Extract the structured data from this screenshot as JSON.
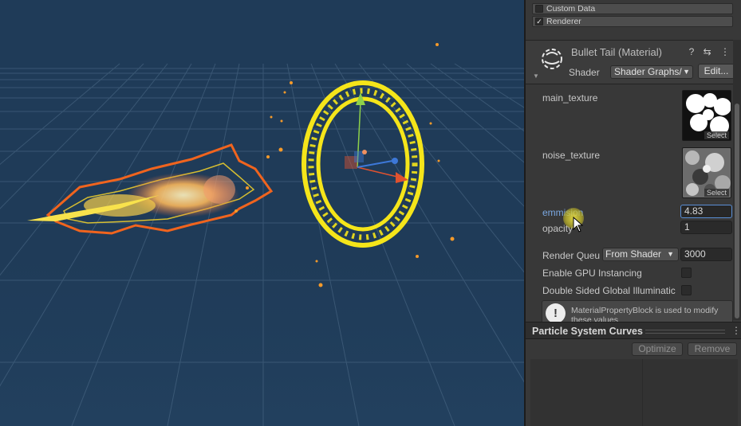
{
  "scene": {
    "gizmo_colors": {
      "x": "#e0522f",
      "y": "#8ed14a",
      "z": "#3d78d8"
    },
    "ring_color": "#f5e51a",
    "trail_color": "#f0641e",
    "sky_color": "#1f3b58",
    "grid_color": "#4f6d8a"
  },
  "inspector": {
    "modules": [
      {
        "label": "Custom Data",
        "checked": false
      },
      {
        "label": "Renderer",
        "checked": true
      }
    ],
    "material": {
      "title": "Bullet Tail (Material)",
      "shader_label": "Shader",
      "shader_value": "Shader Graphs/",
      "edit_button": "Edit...",
      "header_icons": "? ⇆ ⋮"
    },
    "properties": {
      "main_texture": {
        "label": "main_texture",
        "select": "Select"
      },
      "noise_texture": {
        "label": "noise_texture",
        "select": "Select"
      },
      "emmision": {
        "label": "emmision",
        "value": "4.83"
      },
      "opacity": {
        "label": "opacity",
        "value": "1"
      },
      "render_queue": {
        "label": "Render Queu",
        "option": "From Shader",
        "value": "3000"
      },
      "gpu_instancing": {
        "label": "Enable GPU Instancing",
        "checked": false
      },
      "double_sided_gi": {
        "label": "Double Sided Global Illuminatic",
        "checked": false
      }
    },
    "help_text": "MaterialPropertyBlock is used to modify these values",
    "curves": {
      "title": "Particle System Curves",
      "optimize_button": "Optimize",
      "remove_button": "Remove"
    }
  }
}
